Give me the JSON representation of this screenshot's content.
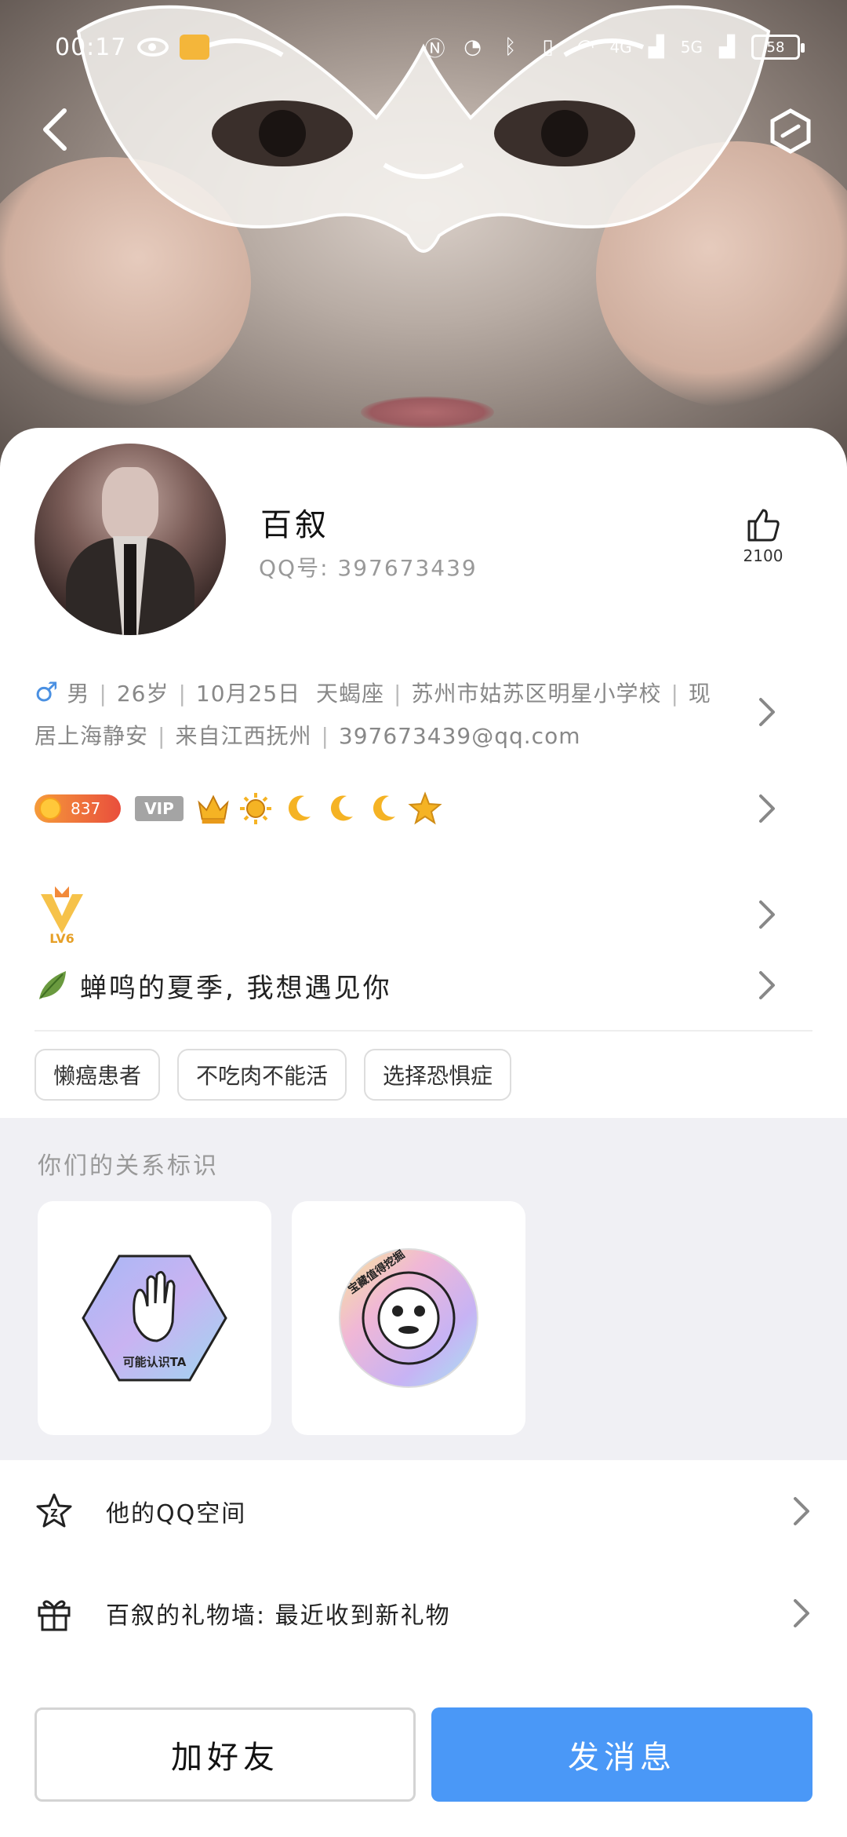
{
  "status_bar": {
    "time": "00:17",
    "network_4g": "4G",
    "network_5g": "5G",
    "battery": "58"
  },
  "profile": {
    "name": "百叙",
    "qq_label": "QQ号: 39767343​9",
    "like_count": "2100"
  },
  "info": {
    "gender": "男",
    "age": "26岁",
    "birthday": "10月25日",
    "zodiac": "天蝎座",
    "school": "苏州市姑苏区明星小学校",
    "current_city": "现居上海静安",
    "hometown": "来自江西抚州",
    "email": "397673439@qq.com"
  },
  "level": {
    "value": "837",
    "vip": "VIP"
  },
  "level_badge": {
    "text": "LV6"
  },
  "signature": "蝉鸣的夏季, 我想遇见你",
  "tags": [
    "懒癌患者",
    "不吃肉不能活",
    "选择恐惧症"
  ],
  "relationship": {
    "title": "你们的关系标识",
    "badges": [
      {
        "label": "可能认识TA"
      },
      {
        "label": "宝藏值得挖掘"
      }
    ]
  },
  "menu": {
    "qzone": "他的QQ空间",
    "gift_wall": "百叙的礼物墙: 最近收到新礼物"
  },
  "actions": {
    "add_friend": "加好友",
    "send_message": "发消息"
  },
  "colors": {
    "accent_blue": "#4a98f7",
    "male_blue": "#4a90e2",
    "level_orange": "#f59b3a"
  }
}
